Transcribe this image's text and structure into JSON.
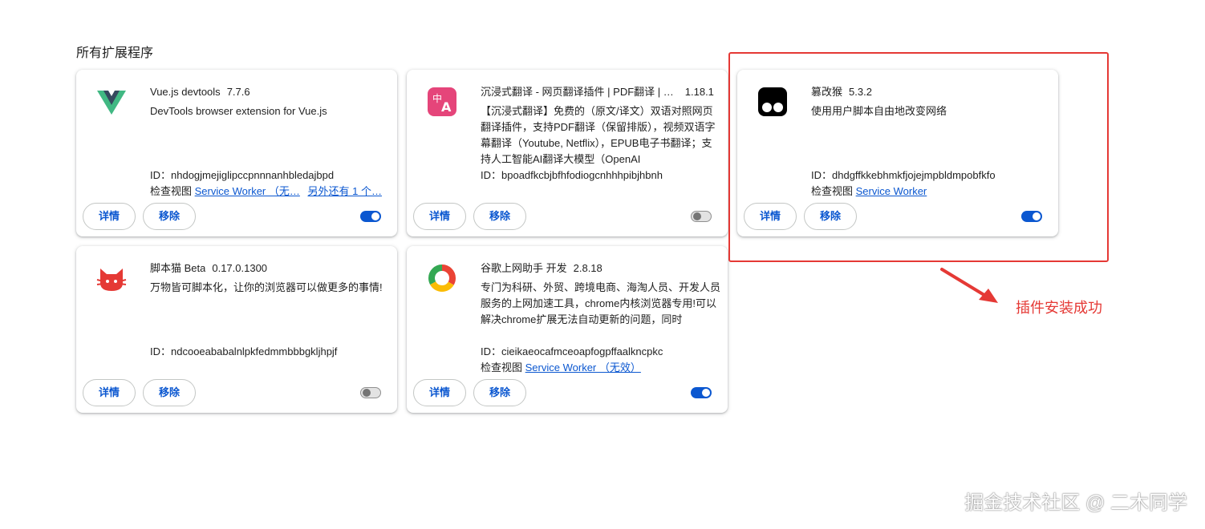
{
  "section_title": "所有扩展程序",
  "common": {
    "details_label": "详情",
    "remove_label": "移除",
    "view_label": "检查视图"
  },
  "extensions": [
    {
      "name": "Vue.js devtools",
      "version": "7.7.6",
      "description": "DevTools browser extension for Vue.js",
      "id_line": "ID：nhdogjmejiglipccpnnnanhbledajbpd",
      "views": [
        "Service Worker （无…",
        "另外还有 1 个…"
      ],
      "enabled": true,
      "icon": "vue-logo-icon"
    },
    {
      "name": "沉浸式翻译 - 网页翻译插件 | PDF翻译 | …",
      "version": "1.18.1",
      "description": "【沉浸式翻译】免费的（原文/译文）双语对照网页翻译插件，支持PDF翻译（保留排版），视频双语字幕翻译（Youtube, Netflix），EPUB电子书翻译；支持人工智能AI翻译大模型（OpenAI",
      "id_line": "ID：bpoadfkcbjbfhfodiogcnhhhpibjhbnh",
      "views": [],
      "enabled": false,
      "icon": "immersive-translate-icon"
    },
    {
      "name": "篡改猴",
      "version": "5.3.2",
      "description": "使用用户脚本自由地改变网络",
      "id_line": "ID：dhdgffkkebhmkfjojejmpbldmpobfkfo",
      "views": [
        "Service Worker"
      ],
      "enabled": true,
      "icon": "tampermonkey-icon"
    },
    {
      "name": "脚本猫 Beta",
      "version": "0.17.0.1300",
      "description": "万物皆可脚本化，让你的浏览器可以做更多的事情!",
      "id_line": "ID：ndcooeababalnlpkfedmmbbbgkljhpjf",
      "views": [],
      "enabled": false,
      "icon": "scriptcat-icon"
    },
    {
      "name": "谷歌上网助手 开发",
      "version": "2.8.18",
      "description": "专门为科研、外贸、跨境电商、海淘人员、开发人员服务的上网加速工具，chrome内核浏览器专用!可以解决chrome扩展无法自动更新的问题，同时",
      "id_line": "ID：cieikaeocafmceoapfogpffaalkncpkc",
      "views": [
        "Service Worker （无效）"
      ],
      "enabled": true,
      "icon": "google-assistant-ring-icon"
    }
  ],
  "annotation": {
    "text": "插件安装成功",
    "color": "#e53935"
  },
  "watermark": "掘金技术社区 @ 二木同学",
  "colors": {
    "accent": "#0b57d0",
    "annotation": "#e53935"
  }
}
